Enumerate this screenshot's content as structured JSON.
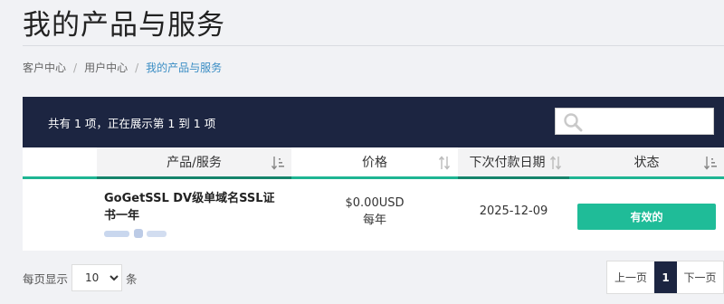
{
  "page": {
    "title": "我的产品与服务"
  },
  "breadcrumb": [
    "客户中心",
    "用户中心",
    "我的产品与服务"
  ],
  "table": {
    "info": "共有 1 项，正在展示第 1 到 1 项",
    "search_placeholder": "",
    "columns": [
      "产品/服务",
      "价格",
      "下次付款日期",
      "状态"
    ],
    "rows": [
      {
        "product": "GoGetSSL DV级单域名SSL证书一年",
        "price": "$0.00USD",
        "cycle": "每年",
        "due_date": "2025-12-09",
        "status": "有效的"
      }
    ]
  },
  "pagination": {
    "per_page_label": "每页显示",
    "per_page_value": "10",
    "per_page_suffix": "条",
    "prev": "上一页",
    "current": "1",
    "next": "下一页"
  },
  "colors": {
    "header_bg": "#1c2541",
    "accent": "#1fb593",
    "status_active": "#1fbc98",
    "breadcrumb_active": "#3a8dc4"
  },
  "icons": [
    "search-icon",
    "sort-icon"
  ]
}
